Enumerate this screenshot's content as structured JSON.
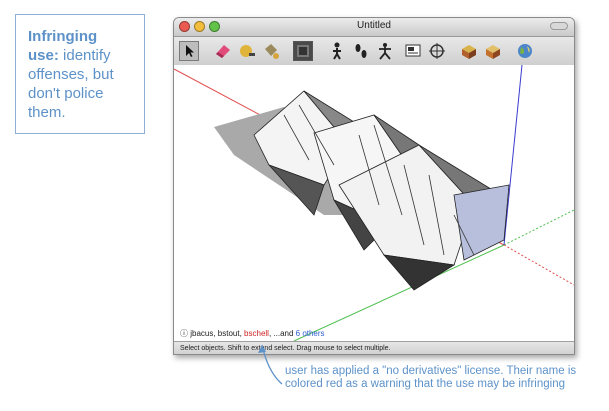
{
  "callout": {
    "bold": "Infringing use:",
    "text": "identify offenses, but don't police them."
  },
  "window": {
    "title": "Untitled"
  },
  "toolbar": {
    "icons": [
      "select-tool-icon",
      "eraser-tool-icon",
      "paint-bucket-icon",
      "component-icon",
      "active-tool-icon",
      "walk-icon",
      "footprints-icon",
      "orbit-icon",
      "section-plane-icon",
      "position-camera-icon",
      "components-browser-icon",
      "materials-icon",
      "earth-icon"
    ]
  },
  "authors": {
    "a1": "jbacus, bstout, ",
    "warn_name": "bschell",
    "mid": ", ...and ",
    "others": "6 others"
  },
  "status": {
    "text": "Select objects. Shift to extend select. Drag mouse to select multiple."
  },
  "note": {
    "text": "user has applied a \"no derivatives\" license. Their name is colored red as a warning that the use may be infringing"
  },
  "colors": {
    "accent": "#5d92c9",
    "warning": "#cc2222",
    "link": "#2a5bd0"
  }
}
